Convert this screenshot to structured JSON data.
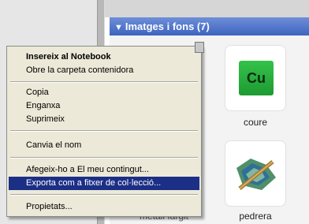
{
  "panel": {
    "header_arrow": "▼",
    "header_title": "Imatges i fons (7)"
  },
  "items": [
    {
      "caption": "coure",
      "tile_text": "Cu"
    },
    {
      "caption": "pedrera"
    },
    {
      "caption": "metall fargit"
    }
  ],
  "context_menu": {
    "items": [
      {
        "label": "Insereix al Notebook"
      },
      {
        "label": "Obre la carpeta contenidora"
      },
      {
        "label": "Copia"
      },
      {
        "label": "Enganxa"
      },
      {
        "label": "Suprimeix"
      },
      {
        "label": "Canvia el nom"
      },
      {
        "label": "Afegeix-ho a El meu contingut..."
      },
      {
        "label": "Exporta com a fitxer de col·lecció..."
      },
      {
        "label": "Propietats..."
      }
    ],
    "highlighted_index": 7
  },
  "colors": {
    "header_blue": "#3d63bf",
    "menu_highlight": "#1c2f86",
    "cu_green": "#2bb041"
  }
}
